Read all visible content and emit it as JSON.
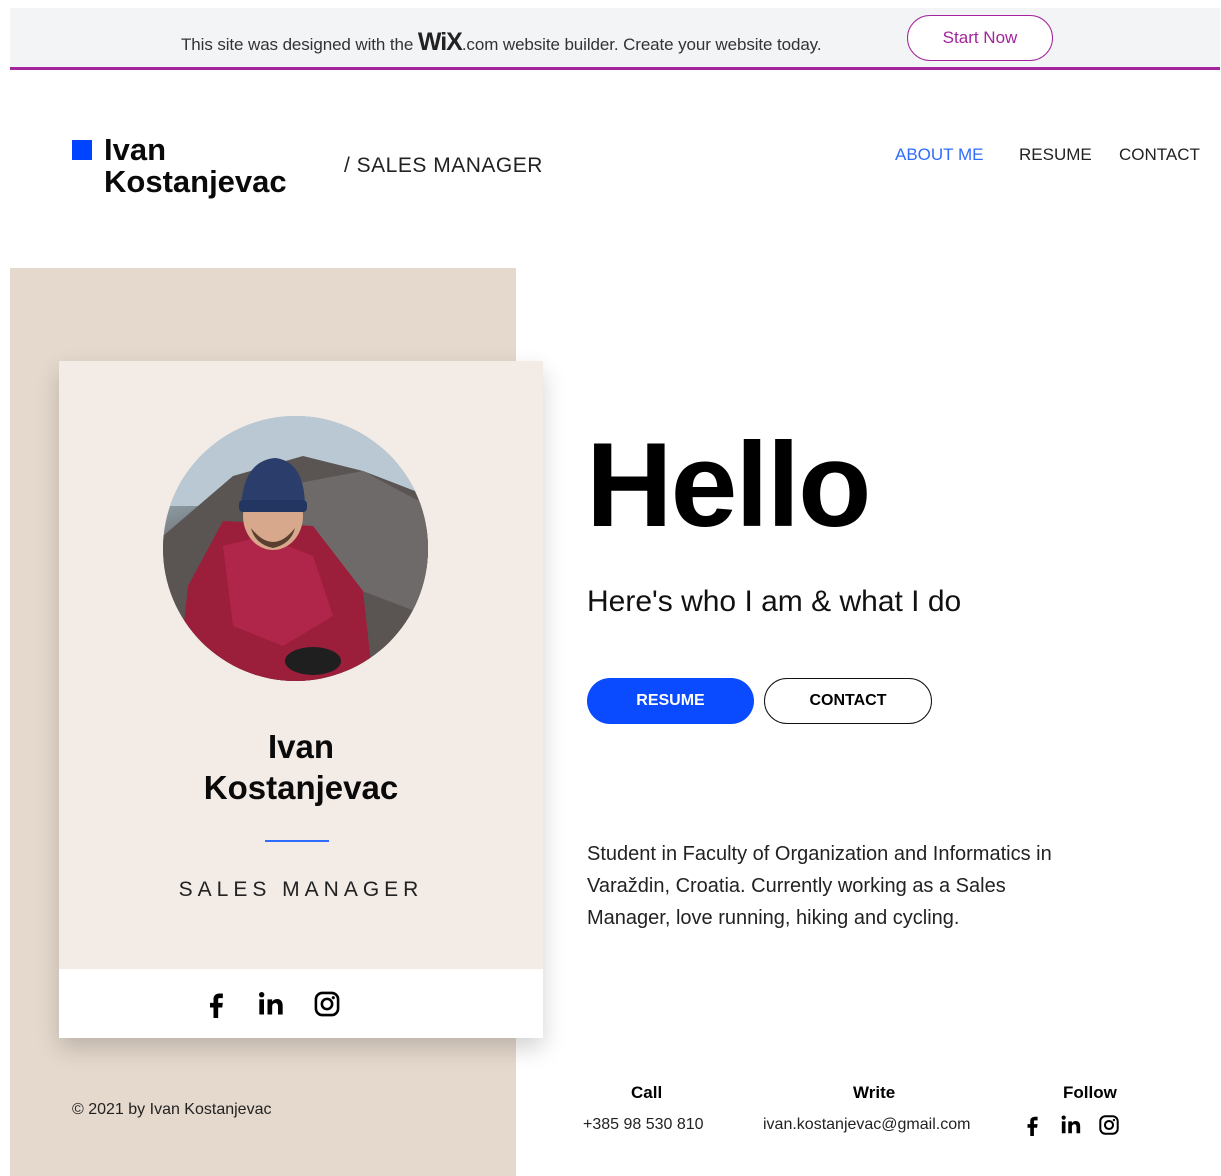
{
  "banner": {
    "text_before": "This site was designed with the ",
    "logo": "WiX",
    "dotcom": ".com",
    "text_after": " website builder. Create your website today.",
    "cta": "Start Now",
    "accent": "#a3249c"
  },
  "header": {
    "name": "Ivan Kostanjevac",
    "title": "/ SALES MANAGER",
    "brand_color": "#0044ff",
    "nav": [
      "ABOUT ME",
      "RESUME",
      "CONTACT"
    ],
    "active_nav": "ABOUT ME"
  },
  "card": {
    "name": "Ivan Kostanjevac",
    "title": "SALES MANAGER",
    "social": [
      "facebook-icon",
      "linkedin-icon",
      "instagram-icon"
    ]
  },
  "hero": {
    "heading": "Hello",
    "subtitle": "Here's who I am & what I do",
    "resume_button": "RESUME",
    "contact_button": "CONTACT",
    "bio": "Student in Faculty of Organization and Informatics in Varaždin, Croatia. Currently working as a Sales Manager, love running, hiking and cycling."
  },
  "footer": {
    "copyright": "© 2021 by Ivan Kostanjevac",
    "call_label": "Call",
    "phone": "+385 98 530 810",
    "write_label": "Write",
    "email": "ivan.kostanjevac@gmail.com",
    "follow_label": "Follow"
  }
}
